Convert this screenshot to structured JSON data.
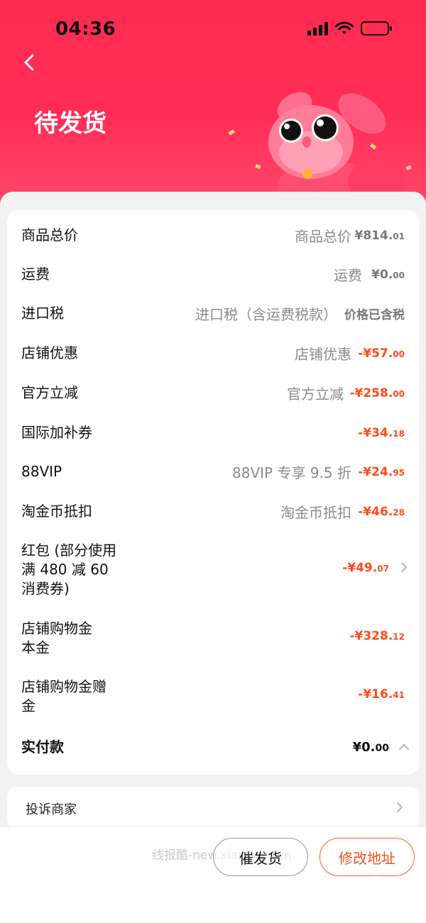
{
  "status_bar": {
    "time": "04:36"
  },
  "header": {
    "title": "待发货"
  },
  "price_rows": [
    {
      "label": "商品总价",
      "desc": "商品总价",
      "amount_main": "¥814.",
      "amount_small": "01",
      "style": "gray"
    },
    {
      "label": "运费",
      "desc": "运费",
      "amount_main": "¥0.",
      "amount_small": "00",
      "style": "gray"
    },
    {
      "label": "进口税",
      "desc": "进口税（含运费税款）",
      "amount_main": "价格已含税",
      "amount_small": "",
      "style": "gray"
    },
    {
      "label": "店铺优惠",
      "desc": "店铺优惠",
      "amount_main": "-¥57.",
      "amount_small": "00",
      "style": "red"
    },
    {
      "label": "官方立减",
      "desc": "官方立减",
      "amount_main": "-¥258.",
      "amount_small": "00",
      "style": "red"
    },
    {
      "label": "国际加补券",
      "desc": "",
      "amount_main": "-¥34.",
      "amount_small": "18",
      "style": "red"
    },
    {
      "label": "88VIP",
      "desc": "88VIP 专享 9.5 折",
      "amount_main": "-¥24.",
      "amount_small": "95",
      "style": "red"
    },
    {
      "label": "淘金币抵扣",
      "desc": "淘金币抵扣",
      "amount_main": "-¥46.",
      "amount_small": "28",
      "style": "red"
    },
    {
      "label": "红包 (部分使用\n满 480 减 60\n消费券)",
      "desc": "",
      "amount_main": "-¥49.",
      "amount_small": "07",
      "style": "red"
    },
    {
      "label": "店铺购物金\n本金",
      "desc": "",
      "amount_main": "-¥328.",
      "amount_small": "12",
      "style": "red"
    },
    {
      "label": "店铺购物金赠\n金",
      "desc": "",
      "amount_main": "-¥16.",
      "amount_small": "41",
      "style": "red"
    }
  ],
  "total": {
    "label": "实付款",
    "amount_main": "¥0.",
    "amount_small": "00"
  },
  "complaint": {
    "label": "投诉商家"
  },
  "bottom": {
    "watermark": "线报酷-new.xianbao.fun",
    "urge_button": "催发货",
    "modify_button": "修改地址"
  },
  "colors": {
    "header": "#ff2d57",
    "discount": "#ff4d1a",
    "accent_button": "#ff5a1f"
  }
}
